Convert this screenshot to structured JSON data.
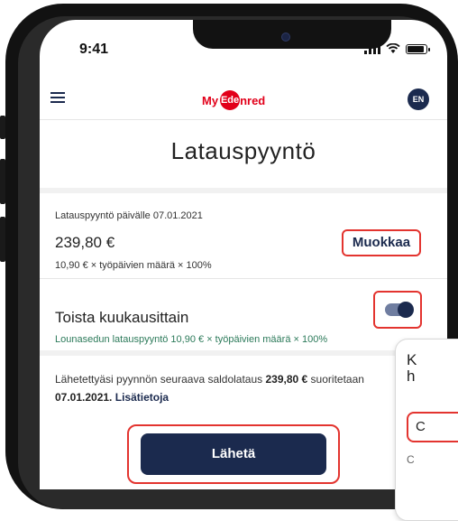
{
  "status_bar": {
    "time": "9:41"
  },
  "header": {
    "logo_part1": "My",
    "logo_part2": "Ede",
    "logo_part3": "nred",
    "language": "EN"
  },
  "page": {
    "title": "Latauspyyntö"
  },
  "request": {
    "date_label": "Latauspyyntö päivälle 07.01.2021",
    "amount": "239,80 €",
    "edit_label": "Muokkaa",
    "formula": "10,90 € × työpäivien määrä × 100%"
  },
  "repeat": {
    "label": "Toista kuukausittain",
    "description": "Lounasedun latauspyyntö 10,90 € × työpäivien määrä × 100%",
    "enabled": true
  },
  "info": {
    "text_before": "Lähetettyäsi pyynnön seuraava saldolataus ",
    "amount": "239,80 €",
    "text_mid": " suoritetaan",
    "date": "07.01.2021.",
    "link": "Lisätietoja"
  },
  "send_button": {
    "label": "Lähetä"
  },
  "popup": {
    "line1": "K",
    "line2": "h",
    "box_text": "C",
    "sub_text": "C"
  },
  "colors": {
    "navy": "#1b2a4e",
    "highlight": "#e3342f",
    "brand_red": "#e2001a"
  }
}
